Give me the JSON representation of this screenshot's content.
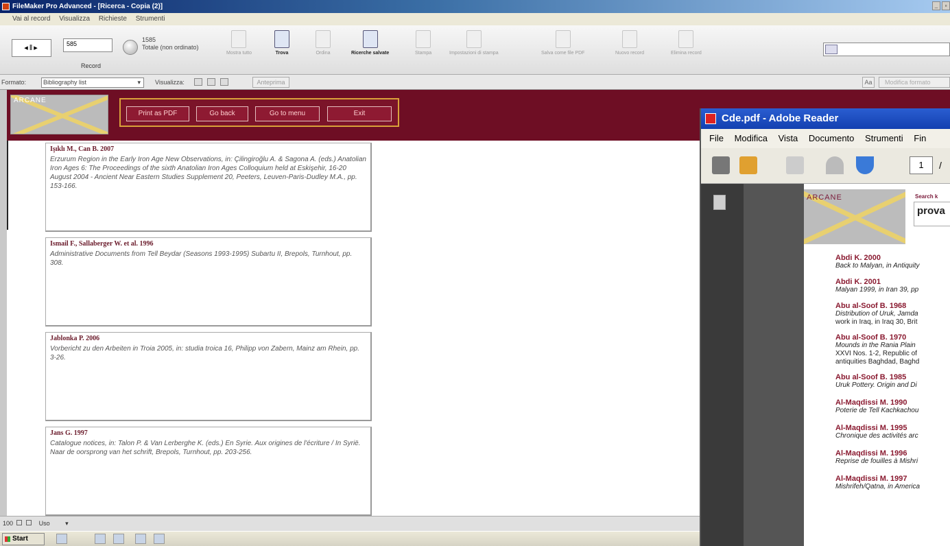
{
  "app": {
    "title": "FileMaker Pro Advanced - [Ricerca - Copia (2)]",
    "menu": [
      "Vai al record",
      "Visualizza",
      "Richieste",
      "Strumenti"
    ]
  },
  "toolbar": {
    "record_value": "585",
    "record_label": "Record",
    "found_count": "1585",
    "found_label": "Totale (non ordinato)",
    "buttons": [
      "Mostra tutto",
      "Trova",
      "Ordina",
      "Ricerche salvate",
      "Stampa",
      "Impostazioni di stampa",
      "Salva come file PDF",
      "Nuovo record",
      "Elimina record"
    ]
  },
  "status": {
    "layout_label": "Formato:",
    "layout_value": "Bibliography list",
    "view_label": "Visualizza:",
    "preview_label": "Anteprima",
    "aa_label": "Aa",
    "edit_layout_label": "Modifica formato"
  },
  "header": {
    "logo_text": "ARCANE",
    "buttons": [
      "Print as PDF",
      "Go back",
      "Go to menu",
      "Exit"
    ]
  },
  "records": [
    {
      "author": "Işıklı M., Can B. 2007",
      "text": "Erzurum Region in the Early Iron Age New Observations, in: Çilingiroğlu A. & Sagona A. (eds.) Anatolian Iron Ages 6: The Proceedings of the sixth Anatolian Iron Ages Colloquium held at Eskişehir, 16-20 August 2004 - Ancient Near Eastern Studies Supplement 20, Peeters, Leuven-Paris-Dudley M.A., pp. 153-166."
    },
    {
      "author": "Ismail F., Sallaberger W. et al. 1996",
      "text": "Administrative Documents from Tell Beydar (Seasons 1993-1995) Subartu II, Brepols, Turnhout, pp. 308."
    },
    {
      "author": "Jablonka P. 2006",
      "text": "Vorbericht zu den Arbeiten in Troia 2005, in: studia troica 16, Philipp von Zabern, Mainz am Rhein, pp. 3-26."
    },
    {
      "author": "Jans G. 1997",
      "text": "Catalogue notices, in: Talon P. & Van Lerberghe K. (eds.) En Syrie. Aux origines de l'écriture / In Syrië. Naar de oorsprong van het schrift, Brepols, Turnhout, pp. 203-256."
    }
  ],
  "fm_status": {
    "zoom": "100",
    "mode": "Uso"
  },
  "taskbar": {
    "start_label": "Start"
  },
  "reader": {
    "title": "Cde.pdf - Adobe Reader",
    "menu": [
      "File",
      "Modifica",
      "Vista",
      "Documento",
      "Strumenti",
      "Fin"
    ],
    "page_number": "1",
    "page_sep": "/",
    "logo_text": "ARCANE",
    "search_label": "Search k",
    "search_value": "prova",
    "entries": [
      {
        "author": "Abdi K. 2000",
        "text": "Back to Malyan, in Antiquity"
      },
      {
        "author": "Abdi K. 2001",
        "text": "Malyan 1999, in Iran 39,  pp"
      },
      {
        "author": "Abu al-Soof B. 1968",
        "text": "Distribution of Uruk, Jamda",
        "text2": "work in Iraq, in Iraq 30, Brit"
      },
      {
        "author": "Abu al-Soof B. 1970",
        "text": "Mounds in the Rania Plain",
        "text2": "XXVI Nos. 1-2, Republic of",
        "text3": "antiquities Baghdad, Baghd"
      },
      {
        "author": "Abu al-Soof B. 1985",
        "text": "Uruk Pottery. Origin and Di"
      },
      {
        "author": "Al-Maqdissi M. 1990",
        "text": "Poterie de Tell Kachkachou"
      },
      {
        "author": "Al-Maqdissi M. 1995",
        "text": "Chronique des activités arc"
      },
      {
        "author": "Al-Maqdissi M. 1996",
        "text": "Reprise de fouilles à Mishri"
      },
      {
        "author": "Al-Maqdissi M. 1997",
        "text": "Mishrifeh/Qatna, in America"
      }
    ]
  }
}
